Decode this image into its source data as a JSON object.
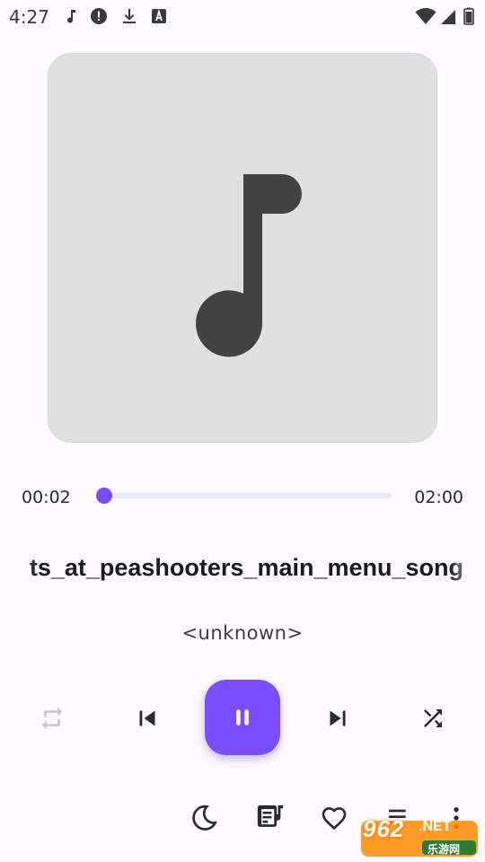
{
  "status_bar": {
    "time": "4:27",
    "notification_icons": [
      "music-note-icon",
      "alert-circle-icon",
      "download-icon",
      "font-a-icon"
    ],
    "system_icons": [
      "wifi-icon",
      "signal-icon",
      "battery-icon"
    ]
  },
  "player": {
    "album_art_icon": "music-note-icon",
    "elapsed": "00:02",
    "total": "02:00",
    "progress_fraction": 0.017,
    "title": "ts_at_peashooters_main_menu_song",
    "artist": "<unknown>",
    "accent_color": "#7c4dff"
  },
  "controls": {
    "repeat_icon": "repeat-icon",
    "previous_icon": "skip-previous-icon",
    "play_pause_icon": "pause-icon",
    "next_icon": "skip-next-icon",
    "shuffle_icon": "shuffle-icon"
  },
  "bottom_bar": {
    "icons": [
      "sleep-timer-icon",
      "lyrics-icon",
      "favorite-icon",
      "queue-icon",
      "more-icon"
    ]
  },
  "watermark": {
    "main": "962",
    "suffix": ".NET",
    "sub": "乐游网"
  }
}
